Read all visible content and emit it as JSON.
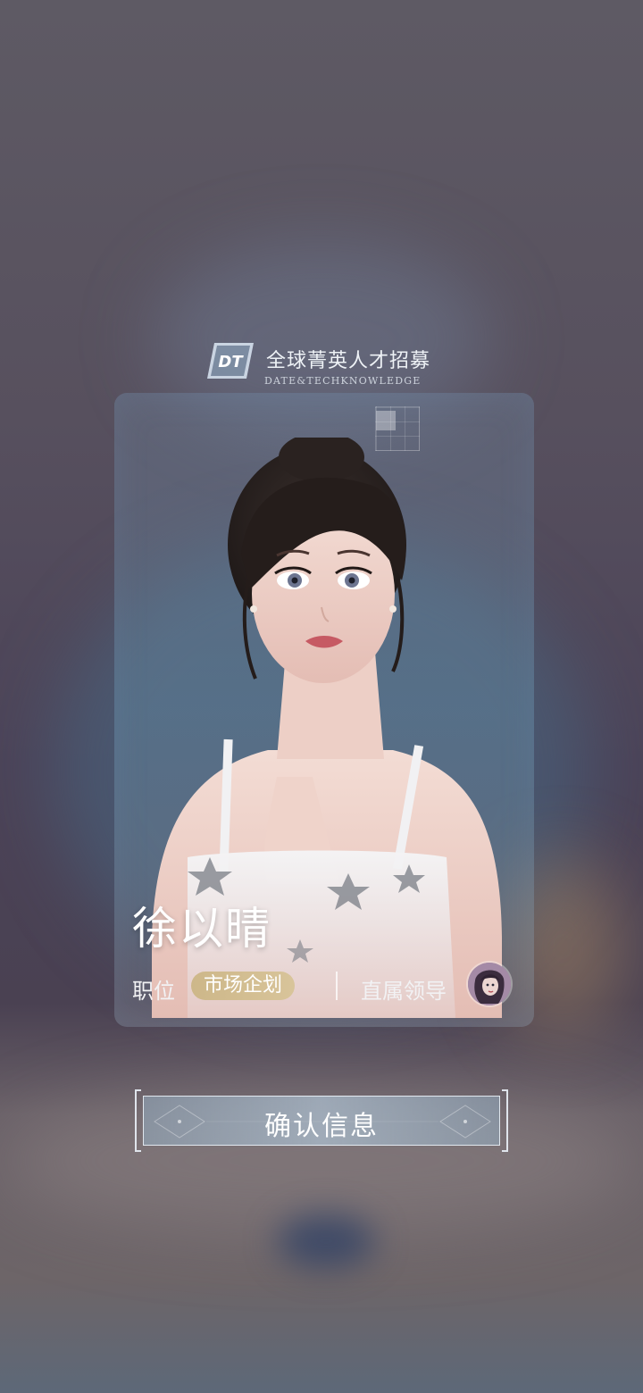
{
  "header": {
    "logo_text": "DT",
    "title": "全球菁英人才招募",
    "subtitle": "DATE&TECHKNOWLEDGE"
  },
  "profile": {
    "name": "徐以晴",
    "position_label": "职位",
    "position_value": "市场企划",
    "leader_label": "直属领导"
  },
  "actions": {
    "confirm_label": "确认信息"
  },
  "colors": {
    "badge": "#d3bf93",
    "text": "#ffffff",
    "background_top": "#5e5a64",
    "background_mid": "#4b4358"
  }
}
